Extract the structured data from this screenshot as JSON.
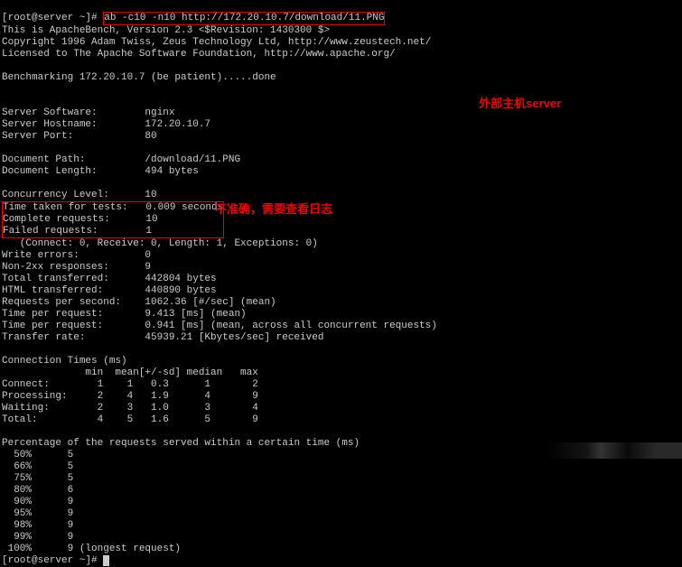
{
  "prompt_start": "[root@server ~]# ",
  "cmd_part_boxed": "ab -c10 -n10 http://172.20.10.7/download/11.PNG",
  "intro1": "This is ApacheBench, Version 2.3 <$Revision: 1430300 $>",
  "intro2": "Copyright 1996 Adam Twiss, Zeus Technology Ltd, http://www.zeustech.net/",
  "intro3": "Licensed to The Apache Software Foundation, http://www.apache.org/",
  "bench": "Benchmarking 172.20.10.7 (be patient).....done",
  "srv_sw": "Server Software:        nginx",
  "srv_host": "Server Hostname:        172.20.10.7",
  "srv_port": "Server Port:            80",
  "doc_path": "Document Path:          /download/11.PNG",
  "doc_len": "Document Length:        494 bytes",
  "conc": "Concurrency Level:      10",
  "time_boxed": "Time taken for tests:   0.009 seconds",
  "complete_boxed": "Complete requests:      10",
  "failed_boxed": "Failed requests:        1",
  "connect": "   (Connect: 0, Receive: 0, Length: 1, Exceptions: 0)",
  "werr": "Write errors:           0",
  "non2xx": "Non-2xx responses:      9",
  "tot_tr": "Total transferred:      442804 bytes",
  "html_tr": "HTML transferred:       440890 bytes",
  "rps": "Requests per second:    1062.36 [#/sec] (mean)",
  "tpr1": "Time per request:       9.413 [ms] (mean)",
  "tpr2": "Time per request:       0.941 [ms] (mean, across all concurrent requests)",
  "rate": "Transfer rate:          45939.21 [Kbytes/sec] received",
  "ct_hdr": "Connection Times (ms)",
  "ct_cols": "              min  mean[+/-sd] median   max",
  "ct_con": "Connect:        1    1   0.3      1       2",
  "ct_pro": "Processing:     2    4   1.9      4       9",
  "ct_wai": "Waiting:        2    3   1.0      3       4",
  "ct_tot": "Total:          4    5   1.6      5       9",
  "pct_hdr": "Percentage of the requests served within a certain time (ms)",
  "p50": "  50%      5",
  "p66": "  66%      5",
  "p75": "  75%      5",
  "p80": "  80%      6",
  "p90": "  90%      9",
  "p95": "  95%      9",
  "p98": "  98%      9",
  "p99": "  99%      9",
  "p100": " 100%      9 (longest request)",
  "prompt_end": "[root@server ~]# ",
  "annot1": "外部主机server",
  "annot2": "不准确，需要查看日志"
}
